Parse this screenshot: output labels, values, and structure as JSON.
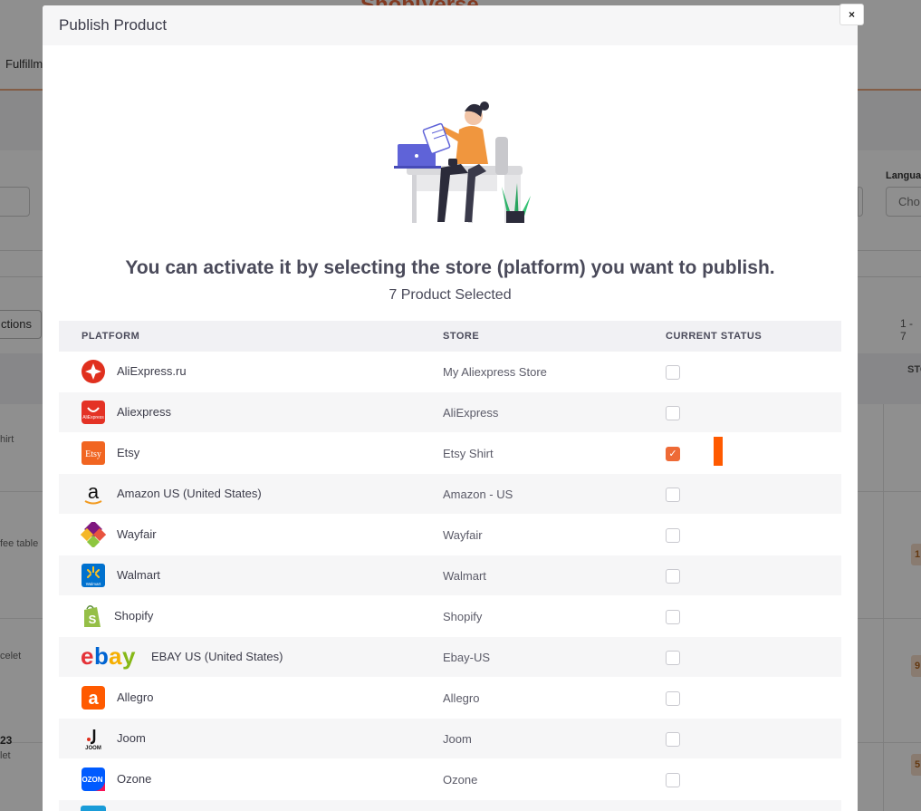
{
  "background": {
    "logo": "ShopiVerse",
    "nav_item": "Fulfillm",
    "language_label": "Langua",
    "language_select": "Cho",
    "actions_label": "ctions",
    "page_info": "1 - 7",
    "column_st": "STO",
    "row_texts": [
      "hirt",
      "fee table",
      "celet",
      "23",
      "let"
    ],
    "badges": [
      "1",
      "9",
      "5"
    ]
  },
  "modal": {
    "title": "Publish Product",
    "close_label": "×",
    "headline": "You can activate it by selecting the store (platform) you want to publish.",
    "subline": "7 Product Selected",
    "columns": {
      "platform": "PLATFORM",
      "store": "STORE",
      "status": "CURRENT STATUS"
    },
    "rows": [
      {
        "platform": "AliExpress.ru",
        "store": "My Aliexpress Store",
        "checked": false,
        "icon": "aliexpress-ru-icon"
      },
      {
        "platform": "Aliexpress",
        "store": "AliExpress",
        "checked": false,
        "icon": "aliexpress-icon"
      },
      {
        "platform": "Etsy",
        "store": "Etsy Shirt",
        "checked": true,
        "icon": "etsy-icon"
      },
      {
        "platform": "Amazon US (United States)",
        "store": "Amazon - US",
        "checked": false,
        "icon": "amazon-icon"
      },
      {
        "platform": "Wayfair",
        "store": "Wayfair",
        "checked": false,
        "icon": "wayfair-icon"
      },
      {
        "platform": "Walmart",
        "store": "Walmart",
        "checked": false,
        "icon": "walmart-icon"
      },
      {
        "platform": "Shopify",
        "store": "Shopify",
        "checked": false,
        "icon": "shopify-icon"
      },
      {
        "platform": "EBAY US (United States)",
        "store": "Ebay-US",
        "checked": false,
        "icon": "ebay-icon"
      },
      {
        "platform": "Allegro",
        "store": "Allegro",
        "checked": false,
        "icon": "allegro-icon"
      },
      {
        "platform": "Joom",
        "store": "Joom",
        "checked": false,
        "icon": "joom-icon"
      },
      {
        "platform": "Ozone",
        "store": "Ozone",
        "checked": false,
        "icon": "ozon-icon"
      }
    ],
    "logo_texts": {
      "aliexpress": "AliExpress",
      "etsy": "Etsy",
      "amazon": "a",
      "walmart": "Walmart",
      "ebay": [
        "e",
        "b",
        "a",
        "y"
      ],
      "allegro": "a",
      "joom": "JOOM",
      "ozon": "OZON"
    }
  },
  "colors": {
    "accent": "#ee6a36",
    "marker": "#ff5a00"
  }
}
